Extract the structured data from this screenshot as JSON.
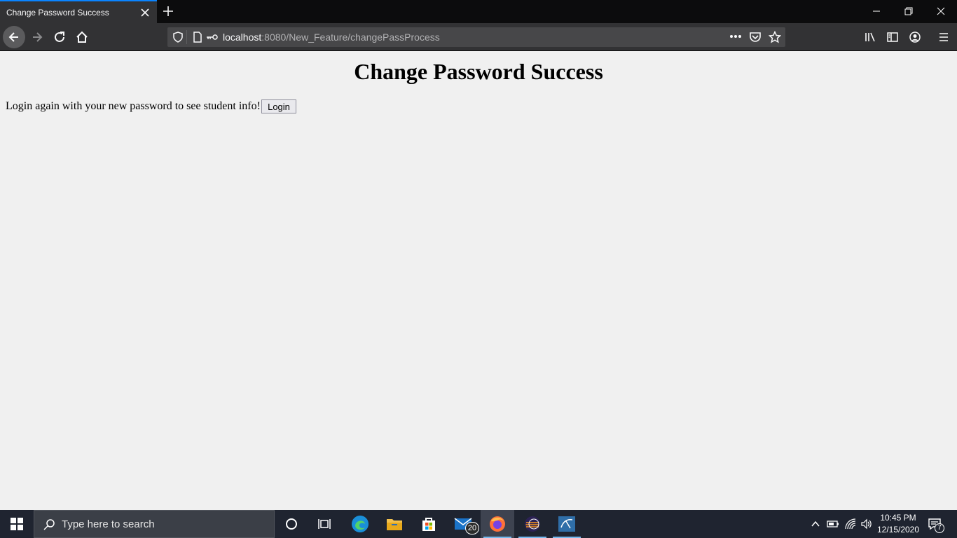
{
  "browser": {
    "tab_title": "Change Password Success",
    "url_host": "localhost",
    "url_rest": ":8080/New_Feature/changePassProcess"
  },
  "page": {
    "heading": "Change Password Success",
    "message": "Login again with your new password to see student info!",
    "login_button": "Login"
  },
  "taskbar": {
    "search_placeholder": "Type here to search",
    "mail_badge": "20",
    "time": "10:45 PM",
    "date": "12/15/2020",
    "notification_count": "7"
  },
  "colors": {
    "tab_accent": "#0a84ff",
    "page_background": "#f0f0f0",
    "taskbar": "#1f2430"
  }
}
